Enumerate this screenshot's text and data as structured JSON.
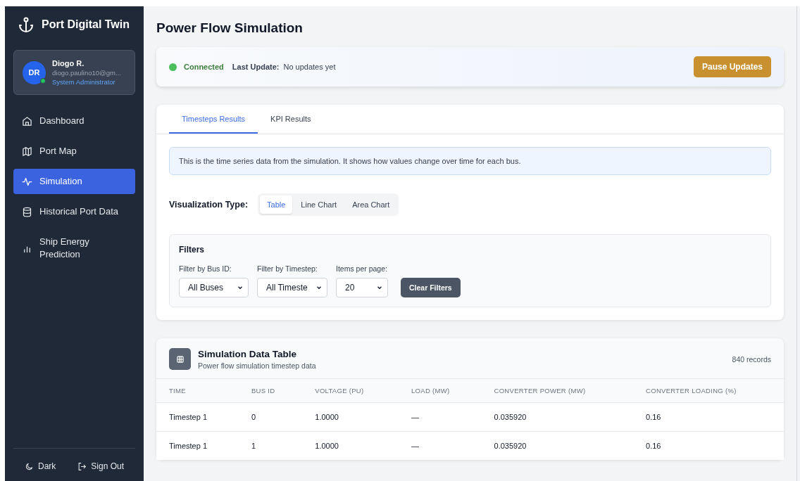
{
  "app": {
    "title": "Port Digital Twin"
  },
  "user": {
    "initials": "DR",
    "name": "Diogo R.",
    "email": "diogo.paulino10@gm...",
    "role": "System Administrator",
    "online": true
  },
  "nav": [
    {
      "label": "Dashboard",
      "selected": false
    },
    {
      "label": "Port Map",
      "selected": false
    },
    {
      "label": "Simulation",
      "selected": true
    },
    {
      "label": "Historical Port Data",
      "selected": false
    },
    {
      "label": "Ship Energy Prediction",
      "selected": false
    }
  ],
  "footer": {
    "theme_label": "Dark",
    "signout_label": "Sign Out"
  },
  "page": {
    "title": "Power Flow Simulation"
  },
  "status": {
    "connected": true,
    "label": "Connected",
    "update_label": "Last Update:",
    "update_value": "No updates yet",
    "button": "Pause Updates"
  },
  "tabs": [
    {
      "label": "Timesteps Results",
      "selected": true
    },
    {
      "label": "KPI Results",
      "selected": false
    }
  ],
  "info": "This is the time series data from the simulation. It shows how values change over time for each bus.",
  "visualization": {
    "label": "Visualization Type:",
    "options": [
      {
        "label": "Table",
        "selected": true
      },
      {
        "label": "Line Chart",
        "selected": false
      },
      {
        "label": "Area Chart",
        "selected": false
      }
    ]
  },
  "filters": {
    "title": "Filters",
    "fields": [
      {
        "label": "Filter by Bus ID:",
        "value": "All Buses"
      },
      {
        "label": "Filter by Timestep:",
        "value": "All Timeste"
      },
      {
        "label": "Items per page:",
        "value": "20"
      }
    ],
    "clear_button": "Clear Filters"
  },
  "table": {
    "title": "Simulation Data Table",
    "subtitle": "Power flow simulation timestep data",
    "count": "840 records",
    "columns": [
      "TIME",
      "BUS ID",
      "VOLTAGE (PU)",
      "LOAD (MW)",
      "CONVERTER POWER (MW)",
      "CONVERTER LOADING (%)"
    ],
    "rows": [
      [
        "Timestep 1",
        "0",
        "1.0000",
        "—",
        "0.035920",
        "0.16"
      ],
      [
        "Timestep 1",
        "1",
        "1.0000",
        "—",
        "0.035920",
        "0.16"
      ]
    ]
  }
}
